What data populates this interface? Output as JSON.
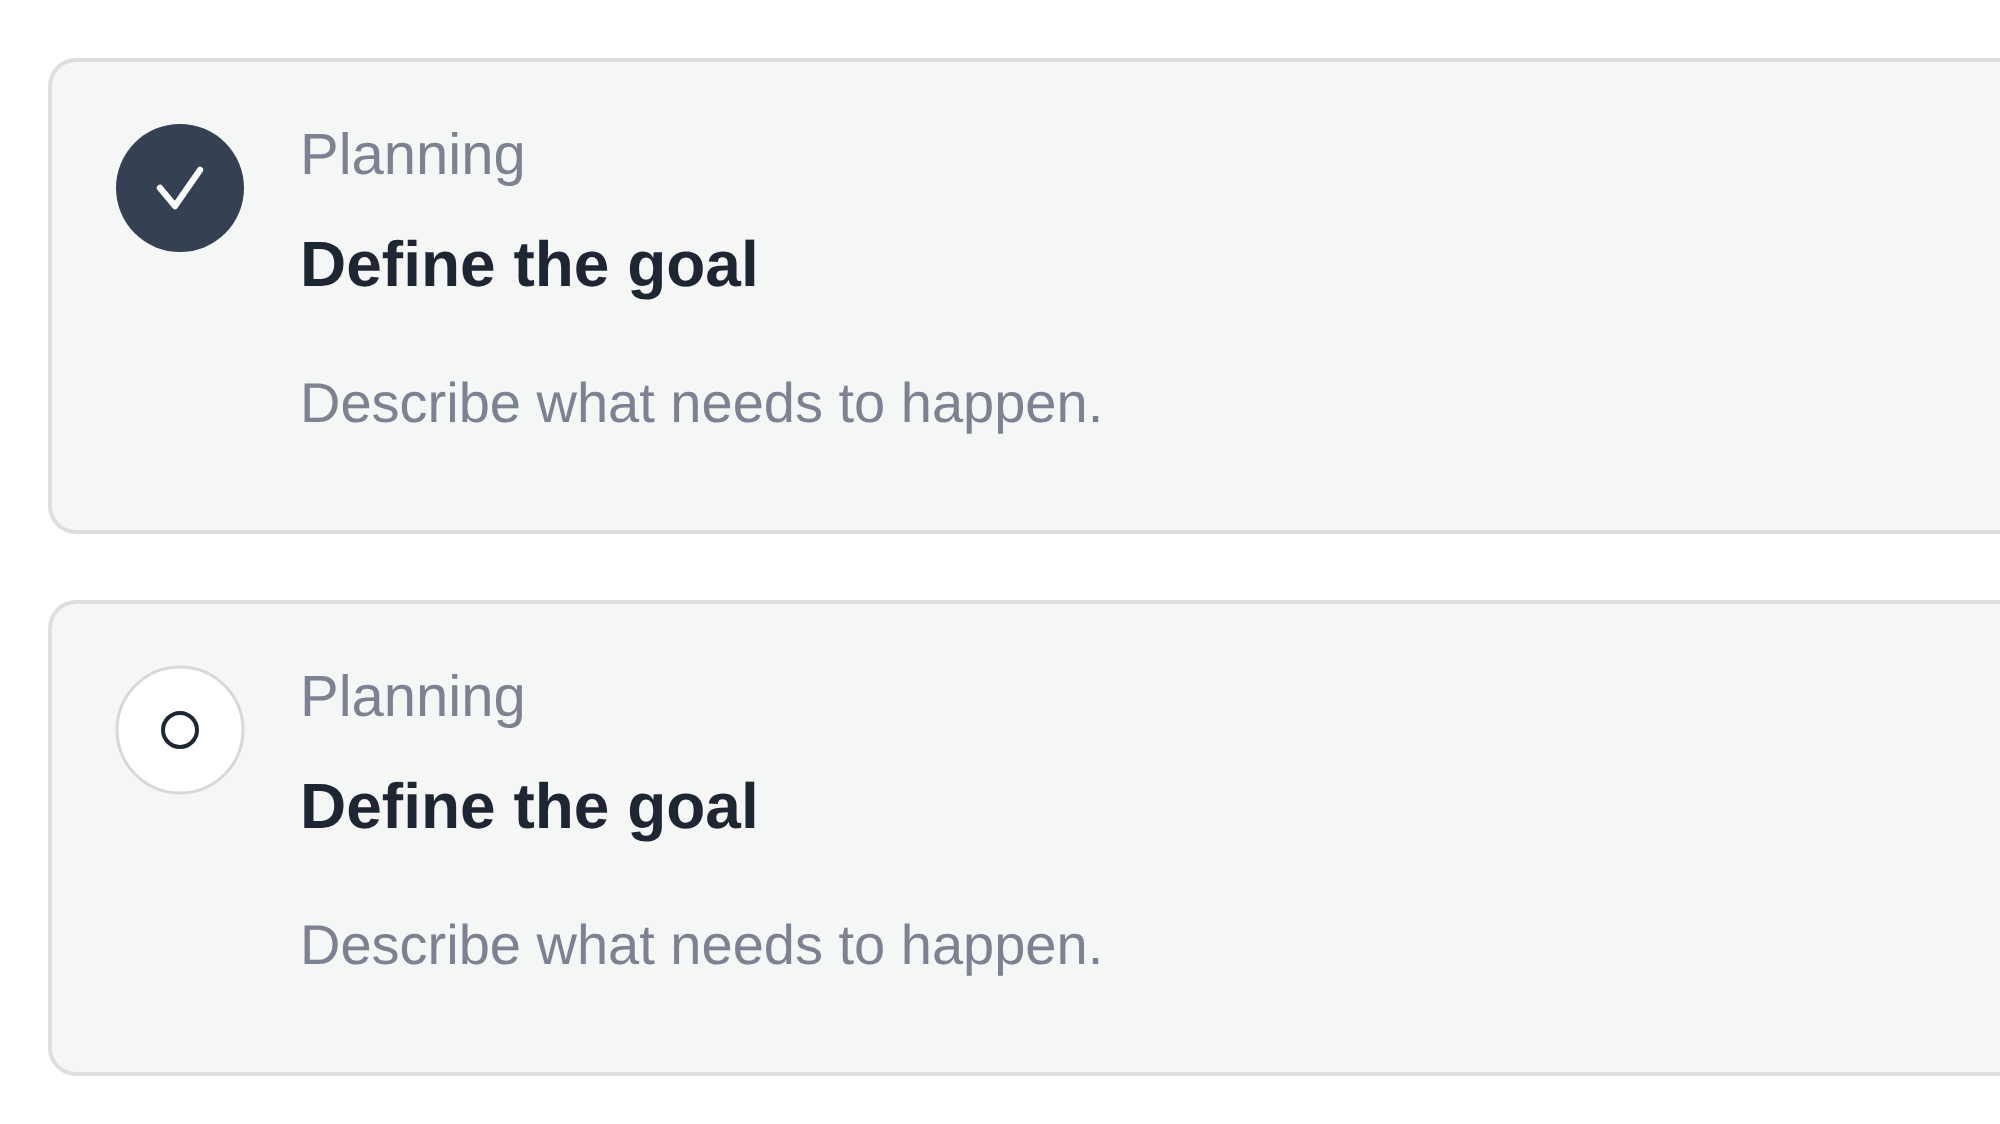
{
  "steps": [
    {
      "category": "Planning",
      "title": "Define the goal",
      "description": "Describe what needs to happen.",
      "done": true
    },
    {
      "category": "Planning",
      "title": "Define the goal",
      "description": "Describe what needs to happen.",
      "done": false
    }
  ]
}
